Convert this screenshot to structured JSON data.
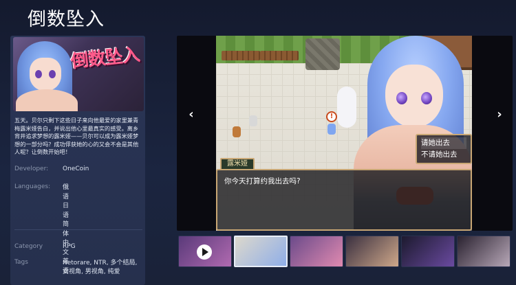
{
  "page": {
    "title": "倒数坠入"
  },
  "capsule": {
    "logo_text": "倒数坠入"
  },
  "info": {
    "description": "五天。贝尔只剩下这些日子来向他最爱的家里兼青梅露米娅告白，并说出他心里最真实的感受。离乡背井追求梦想的露米娅——贝尔可以成为露米娅梦想的一部分吗？成功俘获她的心的又会不会是其他人呢？让倒数开始吧！",
    "developer_label": "Developer:",
    "developer_value": "OneCoin",
    "languages_label": "Languages:",
    "languages": [
      "俄语",
      "日语",
      "简体中文",
      "英语"
    ],
    "category_label": "Category",
    "category_value": "RPG",
    "tags_label": "Tags",
    "tags_line1": "Netorare, NTR, 多个结局,",
    "tags_line2": "女视角, 男视角, 纯爱"
  },
  "viewer": {
    "prev_arrow": "‹",
    "next_arrow": "›",
    "choices": [
      "请她出去",
      "不请她出去"
    ],
    "speaker_name": "露米娅",
    "dialog_text": "你今天打算约我出去吗?",
    "bubble_mark": "!"
  },
  "thumbnails": {
    "selected_index": 1,
    "items": [
      {
        "kind": "video",
        "colors": [
          "#5a3a7a",
          "#b06ab0"
        ]
      },
      {
        "kind": "image",
        "colors": [
          "#dcd8cc",
          "#8faee8"
        ]
      },
      {
        "kind": "image",
        "colors": [
          "#6a4a8a",
          "#e08ab0"
        ]
      },
      {
        "kind": "image",
        "colors": [
          "#3a3040",
          "#cfa88a"
        ]
      },
      {
        "kind": "image",
        "colors": [
          "#1c1a2e",
          "#6a4aa0"
        ]
      },
      {
        "kind": "image",
        "colors": [
          "#2a2230",
          "#b8a8b8"
        ]
      }
    ]
  },
  "colors": {
    "accent_gold": "#c9a774",
    "background": "#1b2540",
    "panel": "#2a3556"
  }
}
